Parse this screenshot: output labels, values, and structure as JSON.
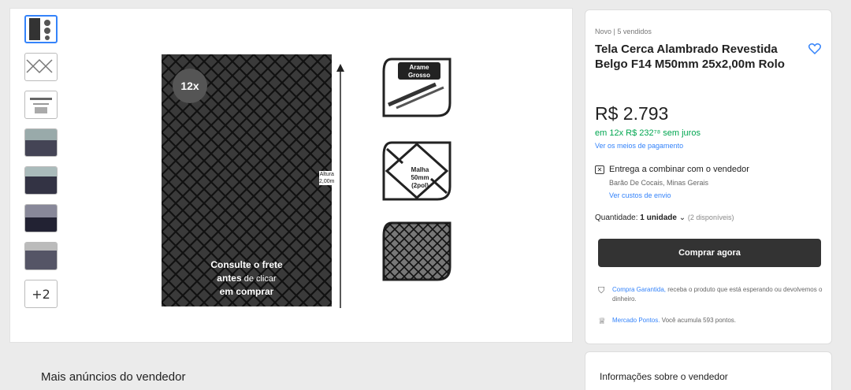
{
  "gallery": {
    "more_label": "+2",
    "badge": "12x",
    "cta_line1": "Consulte o frete",
    "cta_line2_bold": "antes",
    "cta_line2_rest": " de clicar",
    "cta_line3": "em comprar",
    "height_label_1": "Altura",
    "height_label_2": "2,00m",
    "feature_1_line1": "Arame",
    "feature_1_line2": "Grosso",
    "feature_2_line1": "Malha",
    "feature_2_line2": "50mm",
    "feature_2_line3": "(2pol)"
  },
  "buy_box": {
    "subtitle": "Novo | 5 vendidos",
    "title": "Tela Cerca Alambrado Revestida Belgo F14 M50mm 25x2,00m Rolo",
    "price": "R$ 2.793",
    "installments": "em 12x R$ 232⁷⁸ sem juros",
    "payments_link": "Ver os meios de pagamento",
    "delivery": "Entrega a combinar com o vendedor",
    "location": "Barão De Cocais, Minas Gerais",
    "shipping_link": "Ver custos de envio",
    "quantity_label": "Quantidade:",
    "quantity_value": "1 unidade",
    "quantity_available": "(2 disponíveis)",
    "buy_button": "Comprar agora",
    "guarantee_highlight": "Compra Garantida,",
    "guarantee_text": " receba o produto que está esperando ou devolvemos o dinheiro.",
    "points_highlight": "Mercado Pontos.",
    "points_text": " Você acumula 593 pontos."
  },
  "more_ads_title": "Mais anúncios do vendedor",
  "seller_info_title": "Informações sobre o vendedor"
}
